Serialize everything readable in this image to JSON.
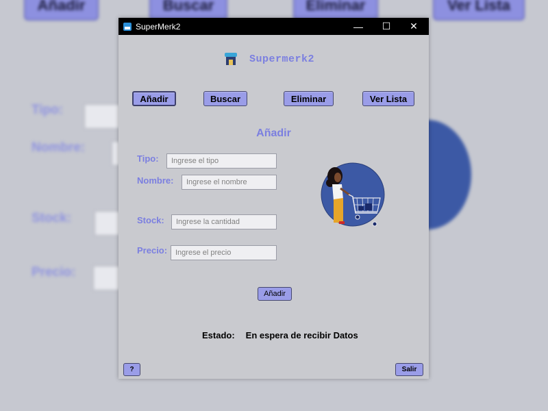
{
  "window": {
    "title": "SuperMerk2",
    "minimize_glyph": "—",
    "maximize_glyph": "☐",
    "close_glyph": "✕"
  },
  "brand": {
    "title": "Supermerk2",
    "icon": "store-icon"
  },
  "nav": {
    "add": "Añadir",
    "search": "Buscar",
    "delete": "Eliminar",
    "list": "Ver Lista"
  },
  "form": {
    "title": "Añadir",
    "fields": {
      "tipo": {
        "label": "Tipo:",
        "placeholder": "Ingrese el tipo",
        "value": ""
      },
      "nombre": {
        "label": "Nombre:",
        "placeholder": "Ingrese el nombre",
        "value": ""
      },
      "stock": {
        "label": "Stock:",
        "placeholder": "Ingrese la cantidad",
        "value": ""
      },
      "precio": {
        "label": "Precio:",
        "placeholder": "Ingrese el precio",
        "value": ""
      }
    },
    "submit_label": "Añadir"
  },
  "status": {
    "label": "Estado:",
    "value": "En espera de recibir Datos"
  },
  "footer": {
    "help_label": "?",
    "exit_label": "Salir"
  },
  "colors": {
    "accent": "#7b7fe0",
    "button_fill": "#9a9de8",
    "window_bg": "#c9cacf",
    "illustration_bg": "#3c59a5"
  }
}
